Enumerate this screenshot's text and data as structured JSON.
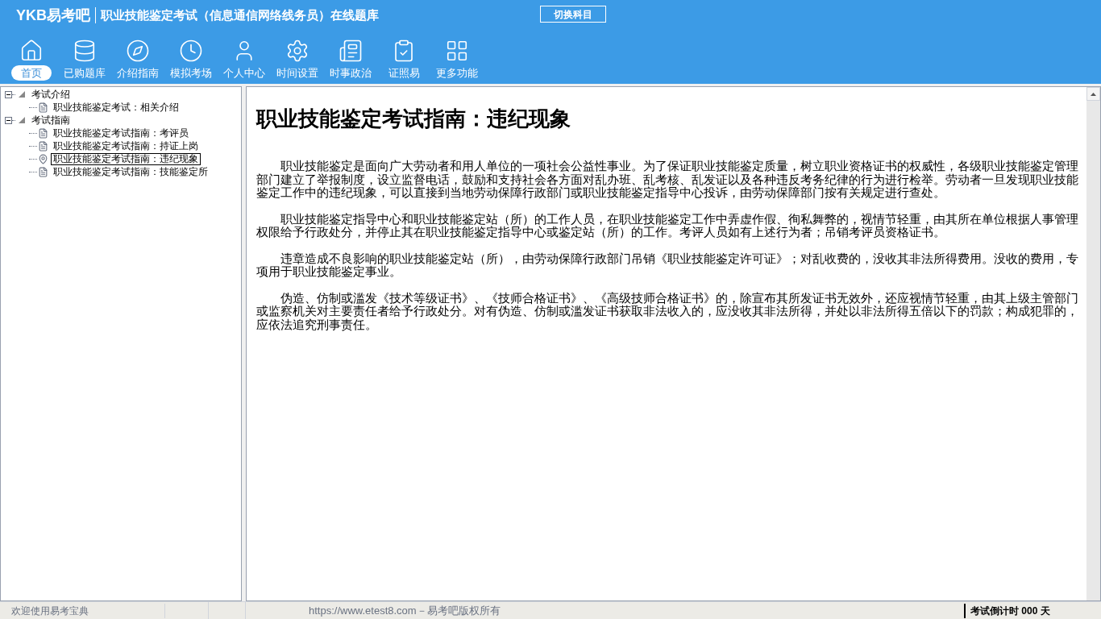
{
  "header": {
    "brand": "YKB易考吧",
    "title": "职业技能鉴定考试（信息通信网络线务员）在线题库",
    "switch_button": "切换科目"
  },
  "toolbar": [
    {
      "label": "首页",
      "selected": true
    },
    {
      "label": "已购题库",
      "selected": false
    },
    {
      "label": "介绍指南",
      "selected": false
    },
    {
      "label": "模拟考场",
      "selected": false
    },
    {
      "label": "个人中心",
      "selected": false
    },
    {
      "label": "时间设置",
      "selected": false
    },
    {
      "label": "时事政治",
      "selected": false
    },
    {
      "label": "证照易",
      "selected": false
    },
    {
      "label": "更多功能",
      "selected": false
    }
  ],
  "tree": [
    {
      "label": "考试介绍",
      "expanded": true,
      "children": [
        {
          "label": "职业技能鉴定考试：相关介绍",
          "selected": false
        }
      ]
    },
    {
      "label": "考试指南",
      "expanded": true,
      "children": [
        {
          "label": "职业技能鉴定考试指南：考评员",
          "selected": false
        },
        {
          "label": "职业技能鉴定考试指南：持证上岗",
          "selected": false
        },
        {
          "label": "职业技能鉴定考试指南：违纪现象",
          "selected": true
        },
        {
          "label": "职业技能鉴定考试指南：技能鉴定所",
          "selected": false
        }
      ]
    }
  ],
  "article": {
    "title": "职业技能鉴定考试指南：违纪现象",
    "paragraphs": [
      "职业技能鉴定是面向广大劳动者和用人单位的一项社会公益性事业。为了保证职业技能鉴定质量，树立职业资格证书的权威性，各级职业技能鉴定管理部门建立了举报制度，设立监督电话，鼓励和支持社会各方面对乱办班、乱考核、乱发证以及各种违反考务纪律的行为进行检举。劳动者一旦发现职业技能鉴定工作中的违纪现象，可以直接到当地劳动保障行政部门或职业技能鉴定指导中心投诉，由劳动保障部门按有关规定进行查处。",
      "职业技能鉴定指导中心和职业技能鉴定站（所）的工作人员，在职业技能鉴定工作中弄虚作假、徇私舞弊的，视情节轻重，由其所在单位根据人事管理权限给予行政处分，并停止其在职业技能鉴定指导中心或鉴定站（所）的工作。考评人员如有上述行为者；吊销考评员资格证书。",
      "违章造成不良影响的职业技能鉴定站（所），由劳动保障行政部门吊销《职业技能鉴定许可证》；对乱收费的，没收其非法所得费用。没收的费用，专项用于职业技能鉴定事业。",
      "伪造、仿制或滥发《技术等级证书》、《技师合格证书》、《高级技师合格证书》的，除宣布其所发证书无效外，还应视情节轻重，由其上级主管部门或监察机关对主要责任者给予行政处分。对有伪造、仿制或滥发证书获取非法收入的，应没收其非法所得，并处以非法所得五倍以下的罚款；构成犯罪的，应依法追究刑事责任。"
    ]
  },
  "status_bar": {
    "welcome": "欢迎使用易考宝典",
    "copyright": "https://www.etest8.com－易考吧版权所有",
    "countdown": "考试倒计时 000 天"
  }
}
